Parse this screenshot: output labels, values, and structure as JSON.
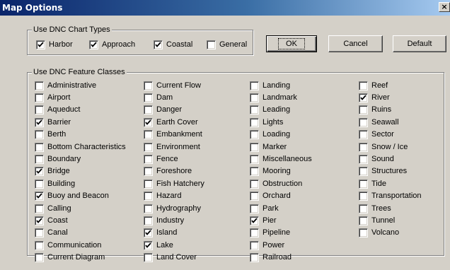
{
  "dialog": {
    "title": "Map Options",
    "close_label": "×"
  },
  "chart_types": {
    "label": "Use DNC Chart Types",
    "items": [
      {
        "label": "Harbor",
        "checked": true
      },
      {
        "label": "Approach",
        "checked": true
      },
      {
        "label": "Coastal",
        "checked": true
      },
      {
        "label": "General",
        "checked": false
      }
    ]
  },
  "buttons": {
    "ok": "OK",
    "cancel": "Cancel",
    "default": "Default"
  },
  "feature_classes": {
    "label": "Use DNC Feature Classes",
    "columns": [
      [
        {
          "label": "Administrative",
          "checked": false
        },
        {
          "label": "Airport",
          "checked": false
        },
        {
          "label": "Aqueduct",
          "checked": false
        },
        {
          "label": "Barrier",
          "checked": true
        },
        {
          "label": "Berth",
          "checked": false
        },
        {
          "label": "Bottom Characteristics",
          "checked": false
        },
        {
          "label": "Boundary",
          "checked": false
        },
        {
          "label": "Bridge",
          "checked": true
        },
        {
          "label": "Building",
          "checked": false
        },
        {
          "label": "Buoy and Beacon",
          "checked": true
        },
        {
          "label": "Calling",
          "checked": false
        },
        {
          "label": "Coast",
          "checked": true
        },
        {
          "label": "Canal",
          "checked": false
        },
        {
          "label": "Communication",
          "checked": false
        },
        {
          "label": "Current Diagram",
          "checked": false
        }
      ],
      [
        {
          "label": "Current Flow",
          "checked": false
        },
        {
          "label": "Dam",
          "checked": false
        },
        {
          "label": "Danger",
          "checked": false
        },
        {
          "label": "Earth Cover",
          "checked": true
        },
        {
          "label": "Embankment",
          "checked": false
        },
        {
          "label": "Environment",
          "checked": false
        },
        {
          "label": "Fence",
          "checked": false
        },
        {
          "label": "Foreshore",
          "checked": false
        },
        {
          "label": "Fish Hatchery",
          "checked": false
        },
        {
          "label": "Hazard",
          "checked": false
        },
        {
          "label": "Hydrography",
          "checked": false
        },
        {
          "label": "Industry",
          "checked": false
        },
        {
          "label": "Island",
          "checked": true
        },
        {
          "label": "Lake",
          "checked": true
        },
        {
          "label": "Land Cover",
          "checked": false
        }
      ],
      [
        {
          "label": "Landing",
          "checked": false
        },
        {
          "label": "Landmark",
          "checked": false
        },
        {
          "label": "Leading",
          "checked": false
        },
        {
          "label": "Lights",
          "checked": false
        },
        {
          "label": "Loading",
          "checked": false
        },
        {
          "label": "Marker",
          "checked": false
        },
        {
          "label": "Miscellaneous",
          "checked": false
        },
        {
          "label": "Mooring",
          "checked": false
        },
        {
          "label": "Obstruction",
          "checked": false
        },
        {
          "label": "Orchard",
          "checked": false
        },
        {
          "label": "Park",
          "checked": false
        },
        {
          "label": "Pier",
          "checked": true
        },
        {
          "label": "Pipeline",
          "checked": false
        },
        {
          "label": "Power",
          "checked": false
        },
        {
          "label": "Railroad",
          "checked": false
        }
      ],
      [
        {
          "label": "Reef",
          "checked": false
        },
        {
          "label": "River",
          "checked": true
        },
        {
          "label": "Ruins",
          "checked": false
        },
        {
          "label": "Seawall",
          "checked": false
        },
        {
          "label": "Sector",
          "checked": false
        },
        {
          "label": "Snow / Ice",
          "checked": false
        },
        {
          "label": "Sound",
          "checked": false
        },
        {
          "label": "Structures",
          "checked": false
        },
        {
          "label": "Tide",
          "checked": false
        },
        {
          "label": "Transportation",
          "checked": false
        },
        {
          "label": "Trees",
          "checked": false
        },
        {
          "label": "Tunnel",
          "checked": false
        },
        {
          "label": "Volcano",
          "checked": false
        }
      ]
    ]
  }
}
